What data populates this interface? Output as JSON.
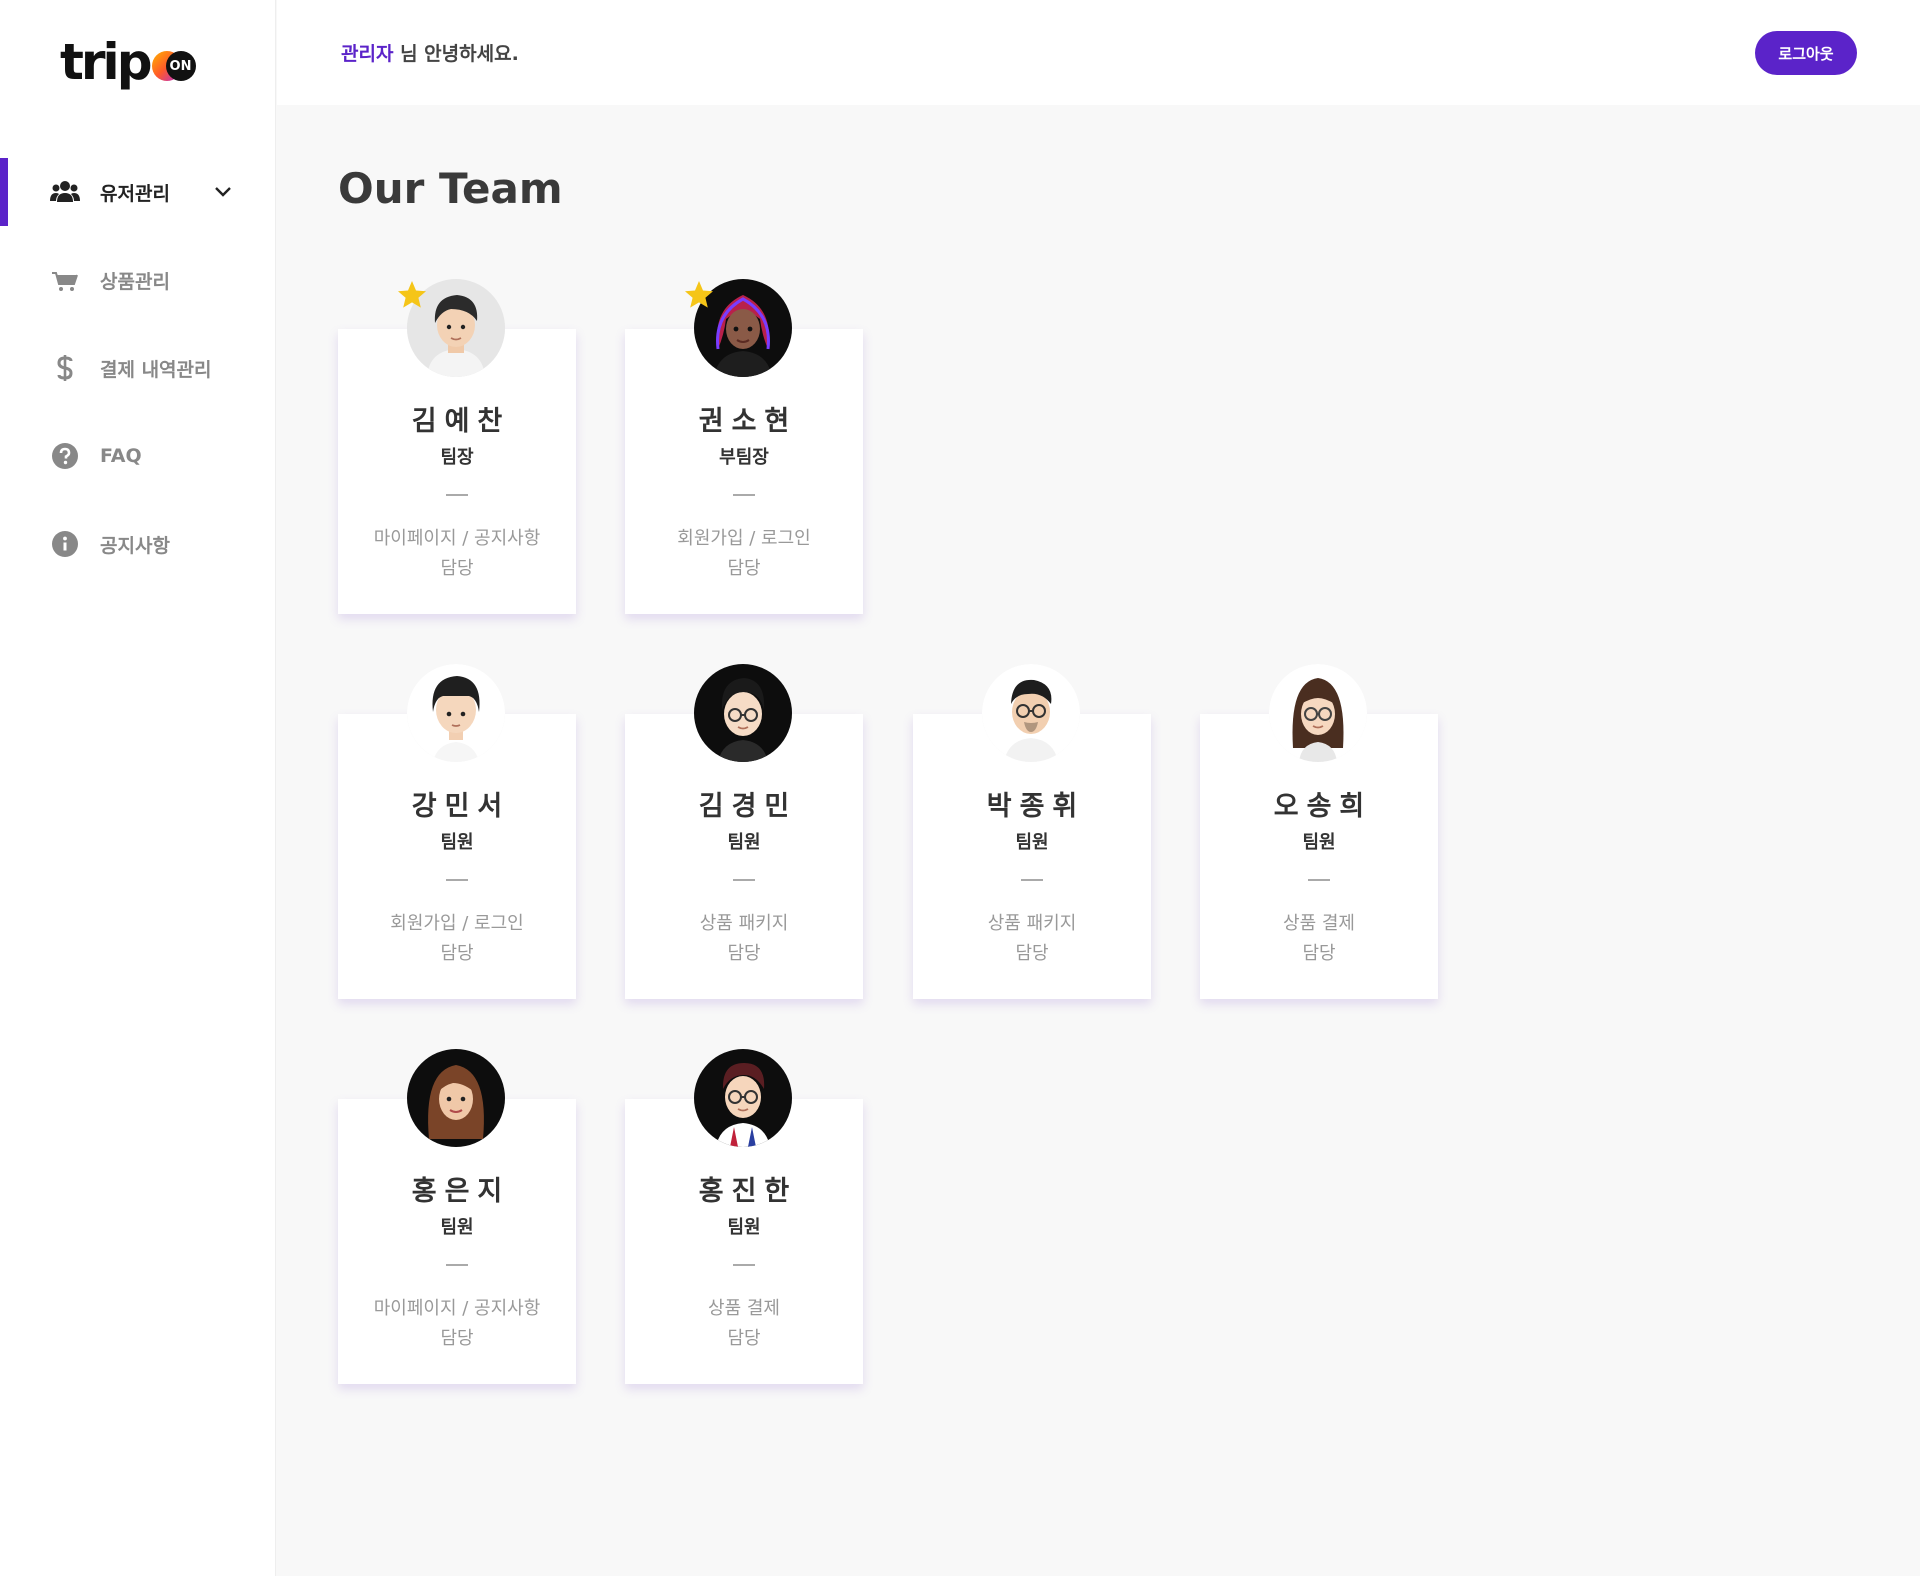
{
  "logo": {
    "text": "trip",
    "badge": "ON"
  },
  "header": {
    "greeting_name": "관리자",
    "greeting_rest": " 님 안녕하세요.",
    "logout_label": "로그아웃"
  },
  "sidebar": {
    "items": [
      {
        "label": "유저관리",
        "icon": "users-icon",
        "active": true
      },
      {
        "label": "상품관리",
        "icon": "cart-icon",
        "active": false
      },
      {
        "label": "결제 내역관리",
        "icon": "dollar-icon",
        "active": false
      },
      {
        "label": "FAQ",
        "icon": "question-circle-icon",
        "active": false
      },
      {
        "label": "공지사항",
        "icon": "info-circle-icon",
        "active": false
      }
    ]
  },
  "main": {
    "title": "Our Team",
    "members": [
      {
        "name": "김예찬",
        "role": "팀장",
        "duty1": "마이페이지 / 공지사항",
        "duty2": "담당",
        "star": true
      },
      {
        "name": "권소현",
        "role": "부팀장",
        "duty1": "회원가입 / 로그인",
        "duty2": "담당",
        "star": true
      },
      {
        "name": "강민서",
        "role": "팀원",
        "duty1": "회원가입 / 로그인",
        "duty2": "담당",
        "star": false
      },
      {
        "name": "김경민",
        "role": "팀원",
        "duty1": "상품 패키지",
        "duty2": "담당",
        "star": false
      },
      {
        "name": "박종휘",
        "role": "팀원",
        "duty1": "상품 패키지",
        "duty2": "담당",
        "star": false
      },
      {
        "name": "오송희",
        "role": "팀원",
        "duty1": "상품 결제",
        "duty2": "담당",
        "star": false
      },
      {
        "name": "홍은지",
        "role": "팀원",
        "duty1": "마이페이지 / 공지사항",
        "duty2": "담당",
        "star": false
      },
      {
        "name": "홍진한",
        "role": "팀원",
        "duty1": "상품 결제",
        "duty2": "담당",
        "star": false
      }
    ]
  },
  "colors": {
    "accent": "#5b23c9",
    "star": "#f5c518"
  }
}
